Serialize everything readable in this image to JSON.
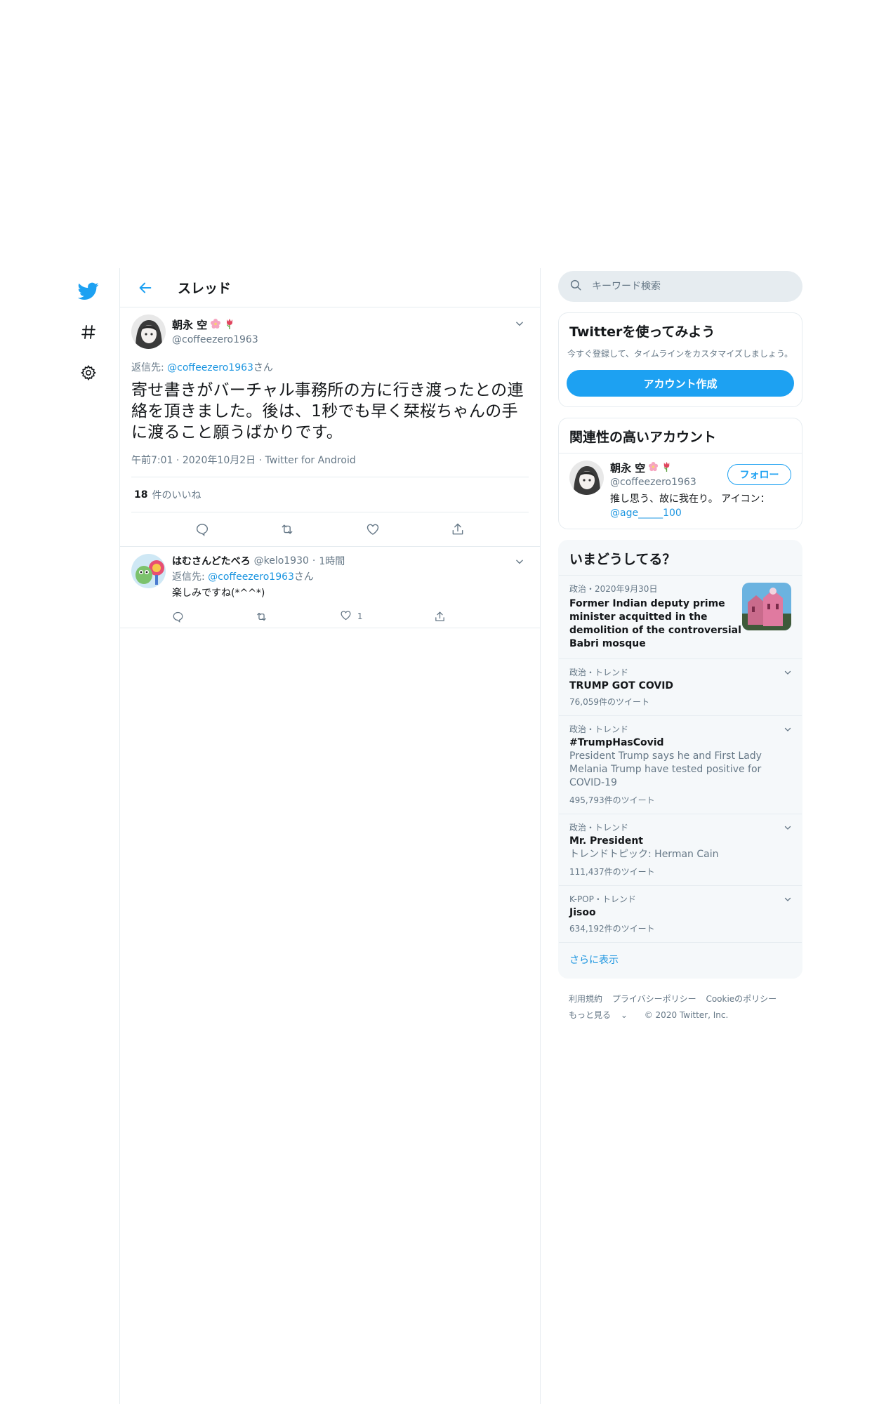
{
  "nav": {
    "twitter_logo": "twitter-bird-icon",
    "explore": "hashtag-icon",
    "settings": "gear-icon"
  },
  "thread": {
    "back": "back-arrow-icon",
    "title": "スレッド"
  },
  "main_tweet": {
    "name": "朝永 空",
    "handle": "@coffeezero1963",
    "reply_prefix": "返信先: ",
    "reply_handle": "@coffeezero1963",
    "reply_suffix": "さん",
    "text": "寄せ書きがバーチャル事務所の方に行き渡ったとの連絡を頂きました。後は、1秒でも早く栞桜ちゃんの手に渡ること願うばかりです。",
    "time": "午前7:01",
    "date": "2020年10月2日",
    "client": "Twitter for Android",
    "likes_count": "18",
    "likes_label": "件のいいね"
  },
  "reply_tweet": {
    "name": "はむさんどたべろ",
    "handle": "@kelo1930",
    "time": "1時間",
    "reply_prefix": "返信先: ",
    "reply_handle": "@coffeezero1963",
    "reply_suffix": "さん",
    "text": "楽しみですね(*^^*)",
    "like_count": "1"
  },
  "search": {
    "placeholder": "キーワード検索"
  },
  "signup": {
    "title": "Twitterを使ってみよう",
    "desc": "今すぐ登録して、タイムラインをカスタマイズしましょう。",
    "button": "アカウント作成"
  },
  "related": {
    "title": "関連性の高いアカウント",
    "name": "朝永 空",
    "handle": "@coffeezero1963",
    "follow": "フォロー",
    "bio": "推し思う、故に我在り。 アイコン：",
    "bio_link": "@age_____100"
  },
  "trends": {
    "title": "いまどうしてる？",
    "news": {
      "meta": "政治・2020年9月30日",
      "headline": "Former Indian deputy prime minister acquitted in the demolition of the controversial Babri mosque"
    },
    "items": [
      {
        "meta": "政治・トレンド",
        "name": "TRUMP GOT COVID",
        "desc": "",
        "count": "76,059件のツイート"
      },
      {
        "meta": "政治・トレンド",
        "name": "#TrumpHasCovid",
        "desc": "President Trump says he and First Lady Melania Trump have tested positive for COVID-19",
        "count": "495,793件のツイート"
      },
      {
        "meta": "政治・トレンド",
        "name": "Mr. President",
        "desc": "トレンドトピック: Herman Cain",
        "count": "111,437件のツイート"
      },
      {
        "meta": "K-POP・トレンド",
        "name": "Jisoo",
        "desc": "",
        "count": "634,192件のツイート"
      }
    ],
    "show_more": "さらに表示"
  },
  "footer": {
    "terms": "利用規約",
    "privacy": "プライバシーポリシー",
    "cookie": "Cookieのポリシー",
    "more": "もっと見る",
    "copyright": "© 2020 Twitter, Inc."
  },
  "colors": {
    "accent": "#1da1f2",
    "link": "#1b95e0",
    "text": "#14171a",
    "muted": "#657786",
    "border": "#e6ecf0",
    "panel": "#f5f8fa"
  }
}
